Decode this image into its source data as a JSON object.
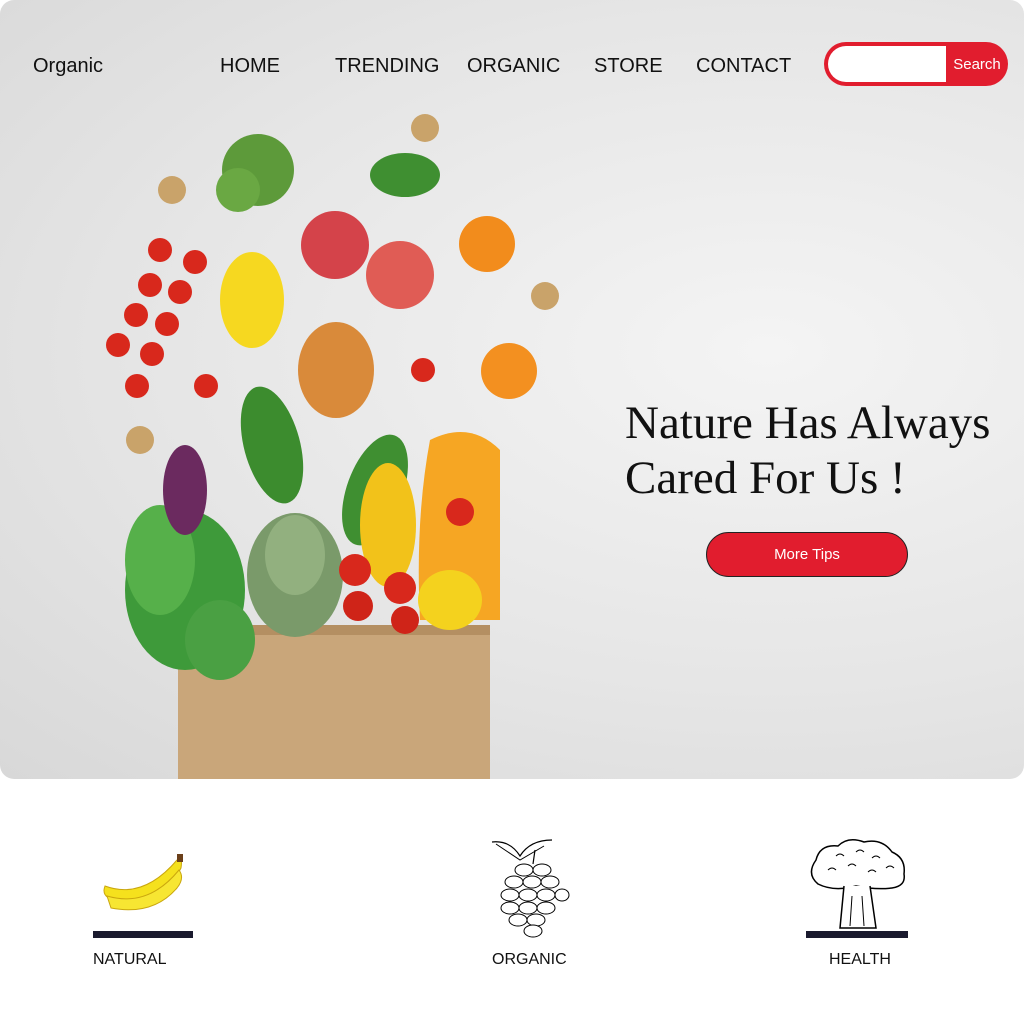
{
  "brand": {
    "logo": "Organic"
  },
  "nav": {
    "items": [
      {
        "label": "HOME"
      },
      {
        "label": "TRENDING"
      },
      {
        "label": "ORGANIC"
      },
      {
        "label": "STORE"
      },
      {
        "label": "CONTACT"
      }
    ]
  },
  "search": {
    "value": "",
    "placeholder": "",
    "button_label": "Search"
  },
  "hero": {
    "headline_line1": "Nature Has Always",
    "headline_line2": "Cared For Us !",
    "cta_label": "More Tips"
  },
  "features": [
    {
      "label": "NATURAL",
      "icon": "banana-icon"
    },
    {
      "label": "ORGANIC",
      "icon": "grapes-icon"
    },
    {
      "label": "HEALTH",
      "icon": "broccoli-icon"
    }
  ],
  "colors": {
    "accent": "#e11d2e",
    "text": "#111111",
    "hero_bg": "#e6e6e6"
  }
}
